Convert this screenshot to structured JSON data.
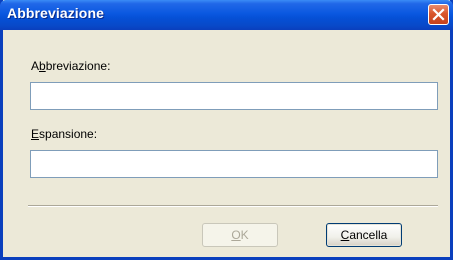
{
  "window": {
    "title": "Abbreviazione"
  },
  "titlebar": {
    "close_icon": "close-icon"
  },
  "form": {
    "abbreviation_label": {
      "mnemonic": "b",
      "prefix": "A",
      "rest": "breviazione:"
    },
    "abbreviation_value": "",
    "expansion_label": {
      "mnemonic": "E",
      "prefix": "",
      "rest": "spansione:"
    },
    "expansion_value": ""
  },
  "buttons": {
    "ok": {
      "mnemonic": "O",
      "rest": "K",
      "enabled": false
    },
    "cancel": {
      "mnemonic": "C",
      "rest": "ancella",
      "enabled": true
    }
  },
  "colors": {
    "titlebar": "#0a58e0",
    "window_bg": "#ece9d8",
    "close_button": "#d9562c",
    "field_border": "#7f9db9"
  }
}
